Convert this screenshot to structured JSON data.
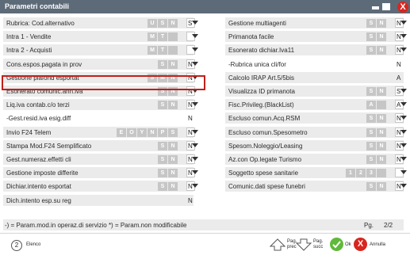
{
  "window": {
    "title": "Parametri contabili",
    "close_glyph": "X"
  },
  "left_rows": [
    {
      "label": "Rubrica: Cod.alternativo",
      "chips": [
        "U",
        "S",
        "N"
      ],
      "value": "S",
      "dropdown": true,
      "plain": false
    },
    {
      "label": "Intra 1 - Vendite",
      "chips": [
        "M",
        "T",
        ""
      ],
      "value": "",
      "dropdown": true,
      "plain": false
    },
    {
      "label": "Intra 2 - Acquisti",
      "chips": [
        "M",
        "T",
        ""
      ],
      "value": "",
      "dropdown": true,
      "plain": false
    },
    {
      "label": "Cons.espos.pagata in prov",
      "chips": [
        "S",
        "N"
      ],
      "value": "N",
      "dropdown": true,
      "plain": false
    },
    {
      "label": "Gestione plafond esportat",
      "chips": [
        "S",
        "M",
        "N"
      ],
      "value": "N",
      "dropdown": true,
      "plain": false
    },
    {
      "label": "Esonerato comunic.ann.iva",
      "chips": [
        "S",
        "N"
      ],
      "value": "N",
      "dropdown": true,
      "plain": false
    },
    {
      "label": "Liq.iva contab.c/o terzi",
      "chips": [
        "S",
        "N"
      ],
      "value": "N",
      "dropdown": true,
      "plain": false
    },
    {
      "label": "-Gest.resid.iva esig.diff",
      "chips": [],
      "value": "N",
      "dropdown": false,
      "plain": true
    },
    {
      "label": "Invio F24 Telem",
      "chips": [
        "E",
        "O",
        "Y",
        "N",
        "P",
        "S"
      ],
      "value": "N",
      "dropdown": true,
      "plain": false
    },
    {
      "label": "Stampa Mod.F24 Semplificato",
      "chips": [
        "S",
        "N"
      ],
      "value": "N",
      "dropdown": true,
      "plain": false
    },
    {
      "label": "Gest.numeraz.effetti cli",
      "chips": [
        "S",
        "N"
      ],
      "value": "N",
      "dropdown": true,
      "plain": false
    },
    {
      "label": "Gestione imposte differite",
      "chips": [
        "S",
        "N"
      ],
      "value": "N",
      "dropdown": true,
      "plain": false
    },
    {
      "label": "Dichiar.intento esportat",
      "chips": [
        "S",
        "N"
      ],
      "value": "N",
      "dropdown": true,
      "plain": false
    },
    {
      "label": "Dich.intento esp.su reg",
      "chips": [],
      "value": "N",
      "dropdown": false,
      "plain": false
    }
  ],
  "right_rows": [
    {
      "label": "Gestione multiagenti",
      "chips": [
        "S",
        "N"
      ],
      "value": "N",
      "dropdown": true,
      "plain": false
    },
    {
      "label": "Primanota facile",
      "chips": [
        "S",
        "N"
      ],
      "value": "N",
      "dropdown": true,
      "plain": false
    },
    {
      "label": "Esonerato dichiar.Iva11",
      "chips": [
        "S",
        "N"
      ],
      "value": "N",
      "dropdown": true,
      "plain": false
    },
    {
      "label": "-Rubrica unica cli/for",
      "chips": [],
      "value": "N",
      "dropdown": false,
      "plain": true
    },
    {
      "label": "Calcolo IRAP Art.5/5bis",
      "chips": [],
      "value": "A",
      "dropdown": false,
      "plain": false
    },
    {
      "label": "Visualizza ID primanota",
      "chips": [
        "S",
        "N"
      ],
      "value": "S",
      "dropdown": true,
      "plain": false
    },
    {
      "label": "Fisc.Privileg.(BlackList)",
      "chips": [
        "A",
        ""
      ],
      "value": "A",
      "dropdown": true,
      "plain": false
    },
    {
      "label": "Escluso comun.Acq.RSM",
      "chips": [
        "S",
        "N"
      ],
      "value": "N",
      "dropdown": true,
      "plain": false
    },
    {
      "label": "Escluso comun.Spesometro",
      "chips": [
        "S",
        "N"
      ],
      "value": "N",
      "dropdown": true,
      "plain": false
    },
    {
      "label": "Spesom.Noleggio/Leasing",
      "chips": [
        "S",
        "N"
      ],
      "value": "N",
      "dropdown": true,
      "plain": false
    },
    {
      "label": "Az.con Op.legate Turismo",
      "chips": [
        "S",
        "N"
      ],
      "value": "N",
      "dropdown": true,
      "plain": false
    },
    {
      "label": "Soggetto spese sanitarie",
      "chips": [
        "1",
        "2",
        "3",
        ""
      ],
      "value": "",
      "dropdown": true,
      "plain": false
    },
    {
      "label": "Comunic.dati spese funebri",
      "chips": [
        "S",
        "N"
      ],
      "value": "N",
      "dropdown": true,
      "plain": false
    }
  ],
  "legend": {
    "text": "-) = Param.mod.in operaz.di servizio   *) = Param.non modificabile",
    "page_label": "Pg.",
    "page_value": "2/2"
  },
  "footer": {
    "elenco_key": "2",
    "elenco_label": "Elenco",
    "pag_prec_label": "Pag. prec",
    "pag_succ_label": "Pag. succ",
    "ok_label": "Ok",
    "annulla_label": "Annulla"
  },
  "colors": {
    "titlebar": "#5d6b78",
    "row_bg": "#ebebeb",
    "chip": "#c6c6c6",
    "highlight_border": "#c0201a",
    "close_red": "#d8261f",
    "ok_green": "#60b93a"
  },
  "icons": {
    "minimize": "minimize-icon",
    "maximize": "maximize-icon",
    "close": "close-icon",
    "pag_prec": "arrow-up-icon",
    "pag_succ": "arrow-down-icon",
    "ok": "checkmark-icon",
    "annulla": "cancel-x-icon"
  }
}
